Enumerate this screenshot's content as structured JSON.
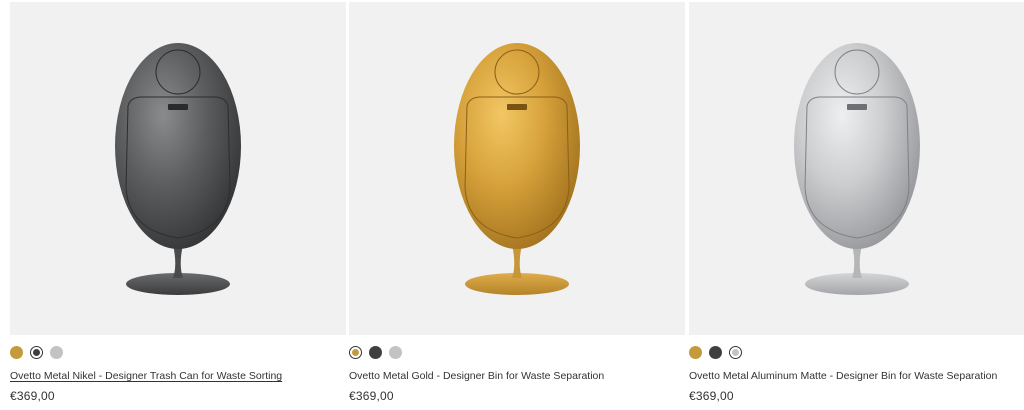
{
  "colors": {
    "gold": "#c49a3c",
    "dark": "#3e3f41",
    "silver": "#c2c3c5",
    "image_bg": "#f1f1f1"
  },
  "products": [
    {
      "title": "Ovetto Metal Nikel - Designer Trash Can for Waste Sorting",
      "price": "€369,00",
      "finish": "nikel",
      "swatches": [
        "gold",
        "dark",
        "silver"
      ],
      "selected_swatch": 1
    },
    {
      "title": "Ovetto Metal Gold - Designer Bin for Waste Separation",
      "price": "€369,00",
      "finish": "gold",
      "swatches": [
        "gold",
        "dark",
        "silver"
      ],
      "selected_swatch": 0
    },
    {
      "title": "Ovetto Metal Aluminum Matte - Designer Bin for Waste Separation",
      "price": "€369,00",
      "finish": "silver",
      "swatches": [
        "gold",
        "dark",
        "silver"
      ],
      "selected_swatch": 2
    }
  ]
}
